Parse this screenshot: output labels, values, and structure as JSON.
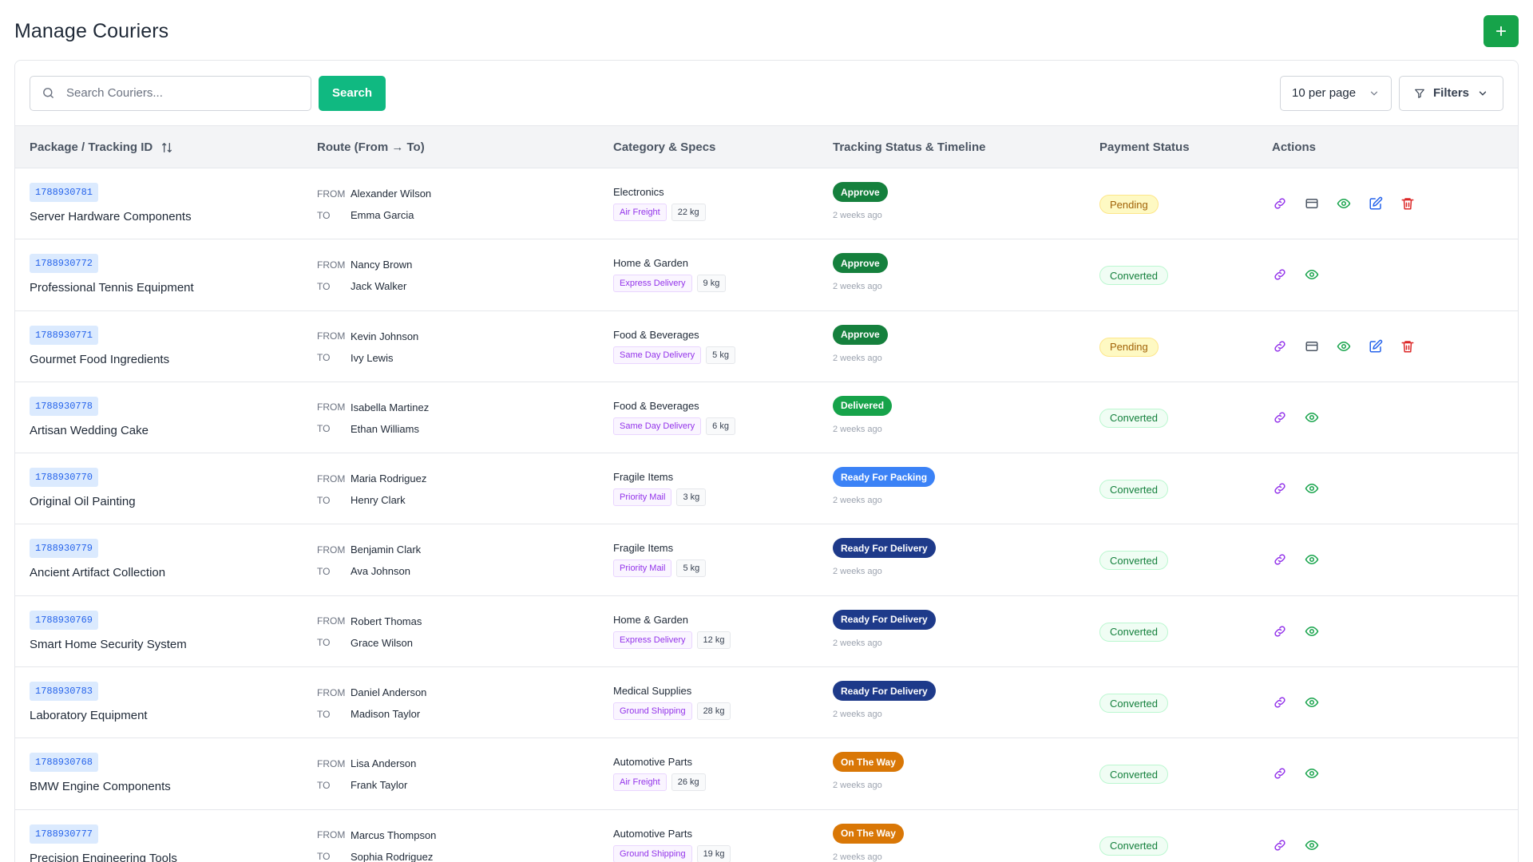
{
  "header": {
    "title": "Manage Couriers",
    "add_icon": "plus-icon"
  },
  "toolbar": {
    "search_placeholder": "Search Couriers...",
    "search_button": "Search",
    "per_page": "10 per page",
    "filters": "Filters"
  },
  "table": {
    "headers": {
      "package": "Package / Tracking ID",
      "route": "Route (From → To)",
      "category": "Category & Specs",
      "tracking": "Tracking Status & Timeline",
      "payment": "Payment Status",
      "actions": "Actions"
    },
    "from_label": "FROM",
    "to_label": "TO",
    "rows": [
      {
        "id": "1788930781",
        "name": "Server Hardware Components",
        "from": "Alexander Wilson",
        "to": "Emma Garcia",
        "category": "Electronics",
        "shipping": "Air Freight",
        "weight": "22 kg",
        "status": "Approve",
        "time": "2 weeks ago",
        "payment": "Pending",
        "actions": [
          "link",
          "card",
          "view",
          "edit",
          "delete"
        ]
      },
      {
        "id": "1788930772",
        "name": "Professional Tennis Equipment",
        "from": "Nancy Brown",
        "to": "Jack Walker",
        "category": "Home & Garden",
        "shipping": "Express Delivery",
        "weight": "9 kg",
        "status": "Approve",
        "time": "2 weeks ago",
        "payment": "Converted",
        "actions": [
          "link",
          "view"
        ]
      },
      {
        "id": "1788930771",
        "name": "Gourmet Food Ingredients",
        "from": "Kevin Johnson",
        "to": "Ivy Lewis",
        "category": "Food & Beverages",
        "shipping": "Same Day Delivery",
        "weight": "5 kg",
        "status": "Approve",
        "time": "2 weeks ago",
        "payment": "Pending",
        "actions": [
          "link",
          "card",
          "view",
          "edit",
          "delete"
        ]
      },
      {
        "id": "1788930778",
        "name": "Artisan Wedding Cake",
        "from": "Isabella Martinez",
        "to": "Ethan Williams",
        "category": "Food & Beverages",
        "shipping": "Same Day Delivery",
        "weight": "6 kg",
        "status": "Delivered",
        "time": "2 weeks ago",
        "payment": "Converted",
        "actions": [
          "link",
          "view"
        ]
      },
      {
        "id": "1788930770",
        "name": "Original Oil Painting",
        "from": "Maria Rodriguez",
        "to": "Henry Clark",
        "category": "Fragile Items",
        "shipping": "Priority Mail",
        "weight": "3 kg",
        "status": "Ready For Packing",
        "time": "2 weeks ago",
        "payment": "Converted",
        "actions": [
          "link",
          "view"
        ]
      },
      {
        "id": "1788930779",
        "name": "Ancient Artifact Collection",
        "from": "Benjamin Clark",
        "to": "Ava Johnson",
        "category": "Fragile Items",
        "shipping": "Priority Mail",
        "weight": "5 kg",
        "status": "Ready For Delivery",
        "time": "2 weeks ago",
        "payment": "Converted",
        "actions": [
          "link",
          "view"
        ]
      },
      {
        "id": "1788930769",
        "name": "Smart Home Security System",
        "from": "Robert Thomas",
        "to": "Grace Wilson",
        "category": "Home & Garden",
        "shipping": "Express Delivery",
        "weight": "12 kg",
        "status": "Ready For Delivery",
        "time": "2 weeks ago",
        "payment": "Converted",
        "actions": [
          "link",
          "view"
        ]
      },
      {
        "id": "1788930783",
        "name": "Laboratory Equipment",
        "from": "Daniel Anderson",
        "to": "Madison Taylor",
        "category": "Medical Supplies",
        "shipping": "Ground Shipping",
        "weight": "28 kg",
        "status": "Ready For Delivery",
        "time": "2 weeks ago",
        "payment": "Converted",
        "actions": [
          "link",
          "view"
        ]
      },
      {
        "id": "1788930768",
        "name": "BMW Engine Components",
        "from": "Lisa Anderson",
        "to": "Frank Taylor",
        "category": "Automotive Parts",
        "shipping": "Air Freight",
        "weight": "26 kg",
        "status": "On The Way",
        "time": "2 weeks ago",
        "payment": "Converted",
        "actions": [
          "link",
          "view"
        ]
      },
      {
        "id": "1788930777",
        "name": "Precision Engineering Tools",
        "from": "Marcus Thompson",
        "to": "Sophia Rodriguez",
        "category": "Automotive Parts",
        "shipping": "Ground Shipping",
        "weight": "19 kg",
        "status": "On The Way",
        "time": "2 weeks ago",
        "payment": "Converted",
        "actions": [
          "link",
          "view"
        ]
      }
    ]
  },
  "colors": {
    "primary_green": "#16a34a",
    "search_green": "#10b981",
    "status": {
      "Approve": "#15803d",
      "Delivered": "#16a34a",
      "Ready For Packing": "#3b82f6",
      "Ready For Delivery": "#1e3a8a",
      "On The Way": "#d97706"
    },
    "payment": {
      "Pending": {
        "bg": "#fef9c3",
        "fg": "#a16207",
        "border": "#fde68a"
      },
      "Converted": {
        "bg": "#f0fdf4",
        "fg": "#15803d",
        "border": "#bbf7d0"
      }
    },
    "actions": {
      "link": "#9333ea",
      "card": "#4b5563",
      "view": "#16a34a",
      "edit": "#2563eb",
      "delete": "#dc2626"
    }
  }
}
